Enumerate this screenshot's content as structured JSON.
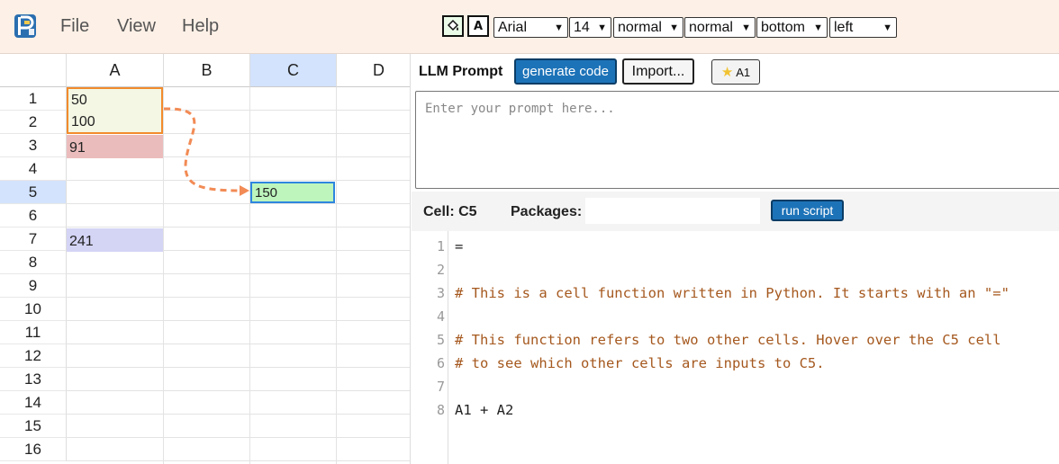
{
  "menu": {
    "file": "File",
    "view": "View",
    "help": "Help"
  },
  "format_toolbar": {
    "text_color_glyph": "A",
    "font": "Arial",
    "size": "14",
    "weight": "normal",
    "style": "normal",
    "vertical_align": "bottom",
    "horizontal_align": "left"
  },
  "sheet": {
    "columns": [
      "A",
      "B",
      "C",
      "D"
    ],
    "rows": [
      "1",
      "2",
      "3",
      "4",
      "5",
      "6",
      "7",
      "8",
      "9",
      "10",
      "11",
      "12",
      "13",
      "14",
      "15",
      "16"
    ],
    "active_column": "C",
    "active_row": "5",
    "cells": {
      "A1": "50",
      "A2": "100",
      "A3": "91",
      "C5": "150",
      "A7": "241"
    },
    "colors": {
      "input_fill": "#f3f7e4",
      "input_border": "#f28b2c",
      "a3_fill": "#ebbcbc",
      "c5_fill": "#bdf5bd",
      "a7_fill": "#d4d4f5",
      "arrow": "#f28b55"
    }
  },
  "llm": {
    "label": "LLM Prompt",
    "generate_label": "generate code",
    "import_label": "Import...",
    "star_cell_label": "A1",
    "prompt_placeholder": "Enter your prompt here..."
  },
  "cell_bar": {
    "cell_label": "Cell: C5",
    "packages_label": "Packages:",
    "run_label": "run script"
  },
  "editor": {
    "lines": [
      {
        "n": "1",
        "text": "=",
        "kind": "code"
      },
      {
        "n": "2",
        "text": "",
        "kind": "code"
      },
      {
        "n": "3",
        "text": "# This is a cell function written in Python. It starts with an \"=\"",
        "kind": "comment"
      },
      {
        "n": "4",
        "text": "",
        "kind": "code"
      },
      {
        "n": "5",
        "text": "# This function refers to two other cells. Hover over the C5 cell",
        "kind": "comment"
      },
      {
        "n": "6",
        "text": "# to see which other cells are inputs to C5.",
        "kind": "comment"
      },
      {
        "n": "7",
        "text": "",
        "kind": "code"
      },
      {
        "n": "8",
        "text": "A1 + A2",
        "kind": "code"
      }
    ]
  }
}
